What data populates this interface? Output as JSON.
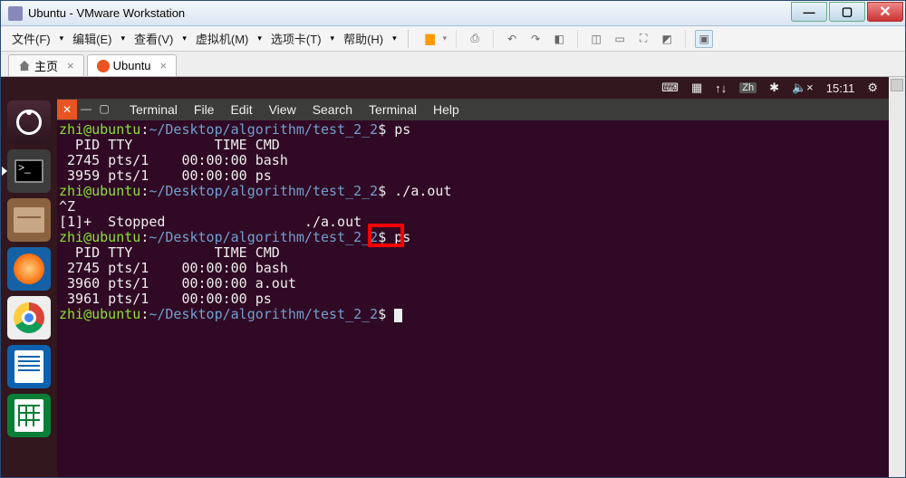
{
  "window": {
    "title": "Ubuntu - VMware Workstation"
  },
  "vm_menu": {
    "file": "文件(F)",
    "edit": "编辑(E)",
    "view": "查看(V)",
    "vm": "虚拟机(M)",
    "tabs": "选项卡(T)",
    "help": "帮助(H)"
  },
  "tabs": {
    "home": "主页",
    "ubuntu": "Ubuntu"
  },
  "ubuntu_panel": {
    "ime": "Zh",
    "time": "15:11"
  },
  "terminal": {
    "menu": {
      "terminal1": "Terminal",
      "file": "File",
      "edit": "Edit",
      "view": "View",
      "search": "Search",
      "terminal2": "Terminal",
      "help": "Help"
    },
    "prompt_user": "zhi@ubuntu",
    "prompt_path": "~/Desktop/algorithm/test_2_2",
    "cmd1": "ps",
    "hdr": "  PID TTY          TIME CMD",
    "ps1_l1": " 2745 pts/1    00:00:00 bash",
    "ps1_l2": " 3959 pts/1    00:00:00 ps",
    "cmd2": "./a.out",
    "susp": "^Z",
    "stopped": "[1]+  Stopped                 ./a.out",
    "cmd3": "ps",
    "hdr2": "  PID TTY          TIME CMD",
    "ps2_l1": " 2745 pts/1    00:00:00 bash",
    "ps2_l2": " 3960 pts/1    00:00:00 a.out",
    "ps2_l3": " 3961 pts/1    00:00:00 ps"
  }
}
